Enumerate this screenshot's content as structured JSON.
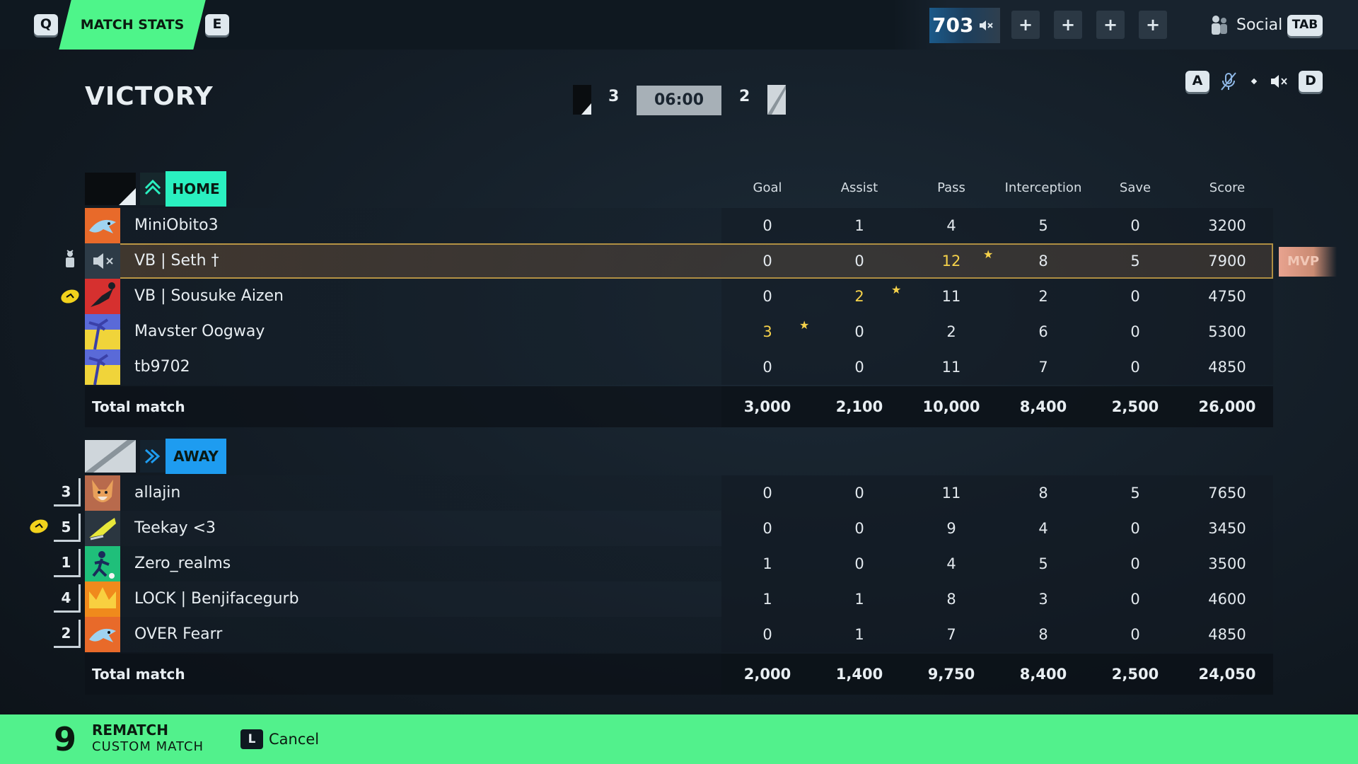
{
  "topbar": {
    "key_prev": "Q",
    "tab_label": "MATCH STATS",
    "key_next": "E",
    "points": "703",
    "slots": [
      "+",
      "+",
      "+",
      "+"
    ],
    "social_label": "Social",
    "social_key": "TAB"
  },
  "header": {
    "result": "VICTORY",
    "home_score": "3",
    "timer": "06:00",
    "away_score": "2",
    "controls": {
      "key_left": "A",
      "key_right": "D"
    }
  },
  "columns": [
    "Goal",
    "Assist",
    "Pass",
    "Interception",
    "Save",
    "Score"
  ],
  "home": {
    "label": "HOME",
    "color": "#2af0c0",
    "players": [
      {
        "name": "MiniObito3",
        "stats": [
          "0",
          "1",
          "4",
          "5",
          "0",
          "3200"
        ],
        "avatar": "shark-avatar"
      },
      {
        "name": "VB | Seth †",
        "stats": [
          "0",
          "0",
          "12",
          "8",
          "5",
          "7900"
        ],
        "avatar": "muted-avatar",
        "mvp": true,
        "highlight_col": 2
      },
      {
        "name": "VB | Sousuke Aizen",
        "stats": [
          "0",
          "2",
          "11",
          "2",
          "0",
          "4750"
        ],
        "avatar": "red-kick-avatar",
        "highlight_col": 1
      },
      {
        "name": "Mavster Oogway",
        "stats": [
          "3",
          "0",
          "2",
          "6",
          "0",
          "5300"
        ],
        "avatar": "palm-avatar",
        "highlight_col": 0
      },
      {
        "name": "tb9702",
        "stats": [
          "0",
          "0",
          "11",
          "7",
          "0",
          "4850"
        ],
        "avatar": "palm-avatar"
      }
    ],
    "total_label": "Total match",
    "totals": [
      "3,000",
      "2,100",
      "10,000",
      "8,400",
      "2,500",
      "26,000"
    ]
  },
  "away": {
    "label": "AWAY",
    "color": "#1e9cf0",
    "players": [
      {
        "rank": "3",
        "name": "allajin",
        "stats": [
          "0",
          "0",
          "11",
          "8",
          "5",
          "7650"
        ],
        "avatar": "fox-avatar"
      },
      {
        "rank": "5",
        "name": "Teekay <3",
        "stats": [
          "0",
          "0",
          "9",
          "4",
          "0",
          "3450"
        ],
        "avatar": "boot-avatar"
      },
      {
        "rank": "1",
        "name": "Zero_realms",
        "stats": [
          "1",
          "0",
          "4",
          "5",
          "0",
          "3500"
        ],
        "avatar": "player-avatar"
      },
      {
        "rank": "4",
        "name": "LOCK | Benjifacegurb",
        "stats": [
          "1",
          "1",
          "8",
          "3",
          "0",
          "4600"
        ],
        "avatar": "crown-avatar"
      },
      {
        "rank": "2",
        "name": "OVER Fearr",
        "stats": [
          "0",
          "1",
          "7",
          "8",
          "0",
          "4850"
        ],
        "avatar": "shark-avatar"
      }
    ],
    "total_label": "Total match",
    "totals": [
      "2,000",
      "1,400",
      "9,750",
      "8,400",
      "2,500",
      "24,050"
    ]
  },
  "mvp_tag": "MVP",
  "bottombar": {
    "countdown": "9",
    "rematch": "REMATCH",
    "mode": "CUSTOM MATCH",
    "cancel_key": "L",
    "cancel_label": "Cancel"
  }
}
